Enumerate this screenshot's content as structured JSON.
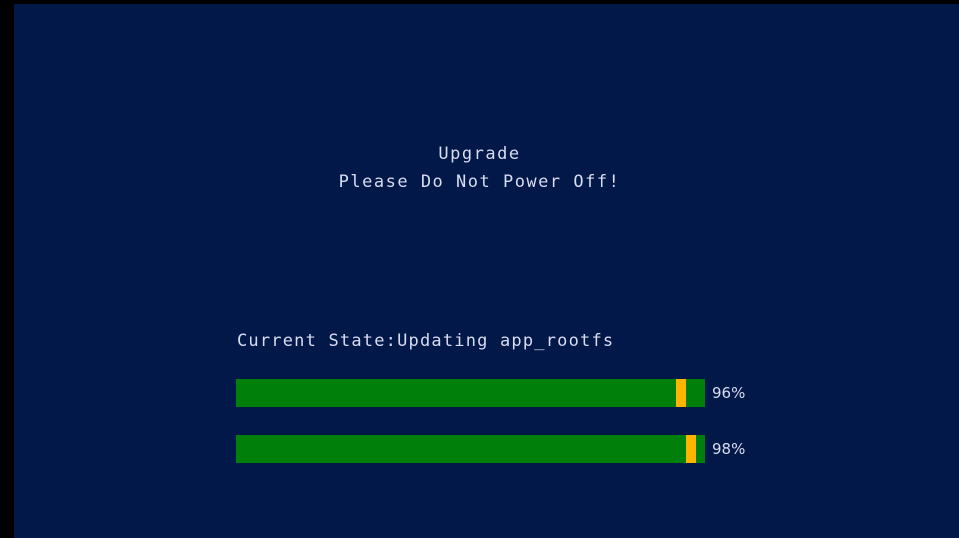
{
  "screen": {
    "title": "Upgrade",
    "warning": "Please Do Not Power Off!"
  },
  "status": {
    "current_state": "Current State:Updating app_rootfs"
  },
  "progress": [
    {
      "label": "96%",
      "value": 96
    },
    {
      "label": "98%",
      "value": 98
    }
  ],
  "colors": {
    "background": "#021849",
    "bar_fill": "#00800b",
    "bar_indicator": "#ffb400",
    "text": "#d8dcef"
  }
}
